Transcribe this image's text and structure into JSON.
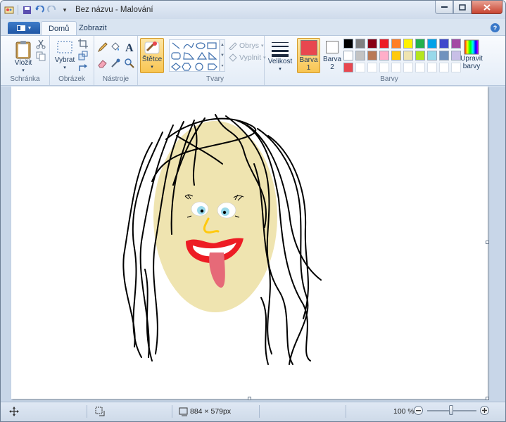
{
  "window": {
    "title": "Bez názvu - Malování"
  },
  "tabs": [
    {
      "label": "Domů"
    },
    {
      "label": "Zobrazit"
    }
  ],
  "ribbon": {
    "clipboard": {
      "paste_label": "Vložit",
      "group_label": "Schránka"
    },
    "image": {
      "select_label": "Vybrat",
      "group_label": "Obrázek"
    },
    "tools": {
      "group_label": "Nástroje"
    },
    "brushes": {
      "label": "Štětce"
    },
    "shapes": {
      "outline_label": "Obrys",
      "fill_label": "Vyplnit",
      "group_label": "Tvary"
    },
    "size": {
      "label": "Velikost"
    },
    "colors": {
      "color1_label": "Barva 1",
      "color1_value": "#e8474f",
      "color2_label": "Barva 2",
      "color2_value": "#ffffff",
      "edit_label": "Upravit barvy",
      "group_label": "Barvy",
      "palette_row1": [
        "#000000",
        "#7f7f7f",
        "#880015",
        "#ed1c24",
        "#ff7f27",
        "#fff200",
        "#22b14c",
        "#00a2e8",
        "#3f48cc",
        "#a349a4"
      ],
      "palette_row2": [
        "#ffffff",
        "#c3c3c3",
        "#b97a57",
        "#ffaec9",
        "#ffc90e",
        "#efe4b0",
        "#b5e61d",
        "#99d9ea",
        "#7092be",
        "#c8bfe7"
      ],
      "palette_row3": [
        "#e8474f",
        "#ffffff",
        "#ffffff",
        "#ffffff",
        "#ffffff",
        "#ffffff",
        "#ffffff",
        "#ffffff",
        "#ffffff",
        "#ffffff"
      ]
    }
  },
  "status": {
    "dimensions": "884 × 579px",
    "zoom": "100 %"
  }
}
